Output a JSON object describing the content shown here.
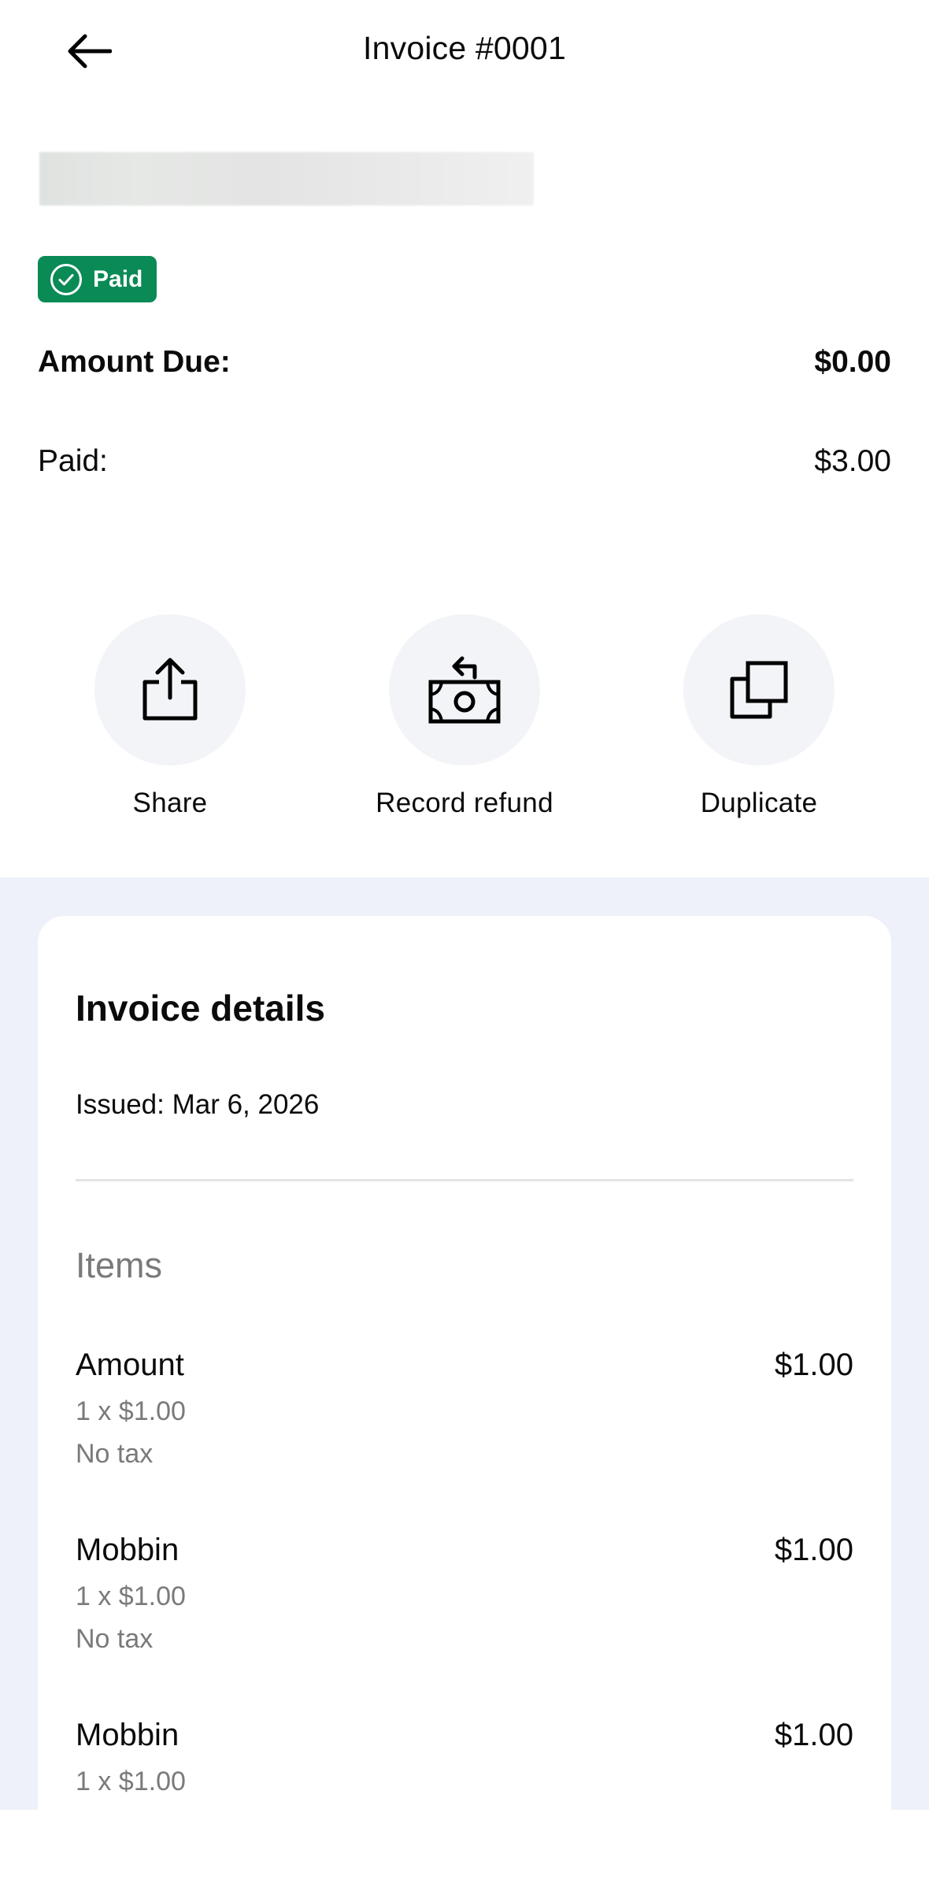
{
  "header": {
    "title": "Invoice #0001"
  },
  "status": {
    "label": "Paid",
    "color": "#0a8a55"
  },
  "summary": {
    "amount_due_label": "Amount Due:",
    "amount_due_value": "$0.00",
    "paid_label": "Paid:",
    "paid_value": "$3.00"
  },
  "actions": [
    {
      "label": "Share",
      "icon": "share-icon"
    },
    {
      "label": "Record refund",
      "icon": "cash-refund-icon"
    },
    {
      "label": "Duplicate",
      "icon": "duplicate-icon"
    }
  ],
  "details": {
    "title": "Invoice details",
    "issued": "Issued: Mar 6, 2026",
    "items_heading": "Items",
    "items": [
      {
        "name": "Amount",
        "price": "$1.00",
        "qty": "1 x $1.00",
        "tax": "No tax"
      },
      {
        "name": "Mobbin",
        "price": "$1.00",
        "qty": "1 x $1.00",
        "tax": "No tax"
      },
      {
        "name": "Mobbin",
        "price": "$1.00",
        "qty": "1 x $1.00"
      }
    ]
  }
}
